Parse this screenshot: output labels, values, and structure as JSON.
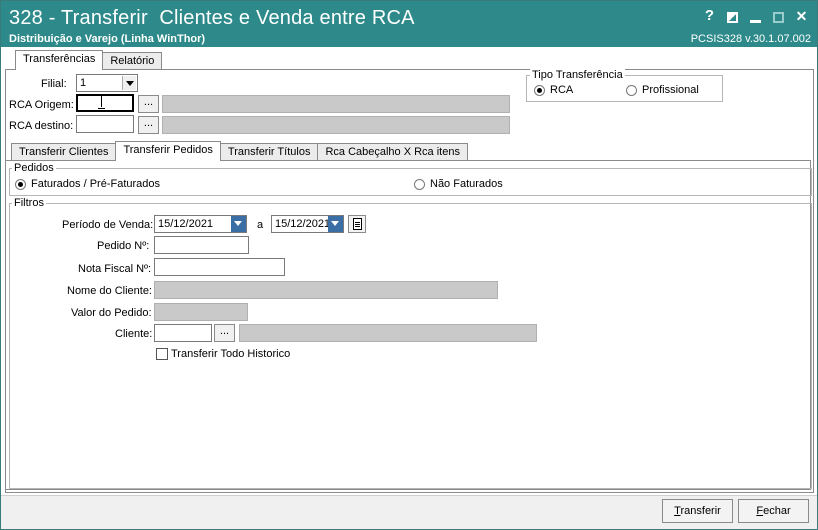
{
  "window": {
    "title": "328 - Transferir  Clientes e Venda entre RCA",
    "subtitle": "Distribuição e Varejo (Linha WinThor)",
    "version": "PCSIS328  v.30.1.07.002",
    "help_label": "?"
  },
  "top_tabs": [
    {
      "label": "Transferências",
      "active": true
    },
    {
      "label": "Relatório",
      "active": false
    }
  ],
  "header": {
    "filial_label": "Filial:",
    "filial_value": "1",
    "rca_origem_label": "RCA Origem:",
    "rca_origem_value": "",
    "rca_destino_label": "RCA destino:",
    "rca_destino_value": "",
    "dots_label": "..."
  },
  "tipo_transferencia": {
    "title": "Tipo Transferência",
    "options": [
      {
        "label": "RCA",
        "selected": true
      },
      {
        "label": "Profissional",
        "selected": false
      }
    ]
  },
  "inner_tabs": [
    {
      "label": "Transferir Clientes",
      "active": false
    },
    {
      "label": "Transferir Pedidos",
      "active": true
    },
    {
      "label": "Transferir Títulos",
      "active": false
    },
    {
      "label": "Rca Cabeçalho X Rca itens",
      "active": false
    }
  ],
  "pedidos": {
    "title": "Pedidos",
    "options": [
      {
        "label": "Faturados / Pré-Faturados",
        "selected": true
      },
      {
        "label": "Não Faturados",
        "selected": false
      }
    ]
  },
  "filtros": {
    "title": "Filtros",
    "periodo_label": "Período de Venda:",
    "date_from": "15/12/2021",
    "date_sep": "a",
    "date_to": "15/12/2021",
    "pedido_label": "Pedido Nº:",
    "pedido_value": "",
    "nota_label": "Nota Fiscal Nº:",
    "nota_value": "",
    "nome_label": "Nome do Cliente:",
    "nome_value": "",
    "valor_label": "Valor do Pedido:",
    "valor_value": "",
    "cliente_label": "Cliente:",
    "cliente_value": "",
    "historico_label": "Transferir Todo Historico",
    "historico_checked": false
  },
  "buttons": {
    "transferir_prefix": "",
    "transferir_u": "T",
    "transferir_rest": "ransferir",
    "fechar_u": "F",
    "fechar_rest": "echar"
  },
  "icons": [
    "minimize-icon",
    "maximize-icon",
    "close-icon",
    "calendar-icon",
    "chevron-down-icon"
  ],
  "colors": {
    "titlebar": "#2e8a8a"
  }
}
